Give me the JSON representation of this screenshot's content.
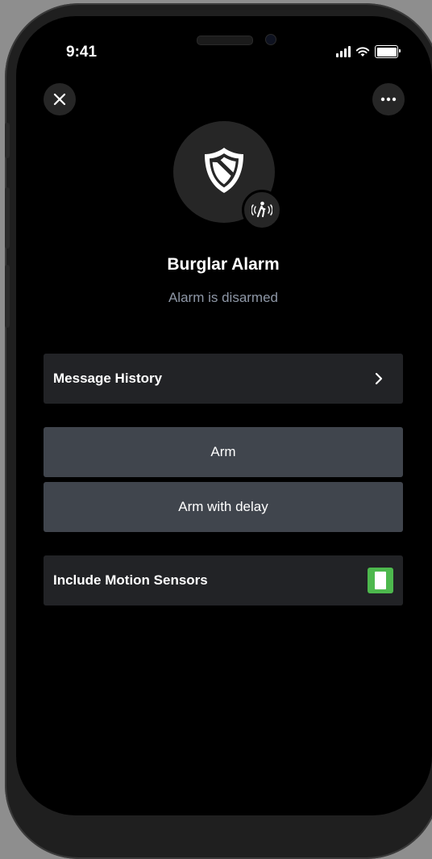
{
  "status_bar": {
    "time": "9:41"
  },
  "header": {
    "close_icon": "close-icon",
    "more_icon": "more-dots-icon"
  },
  "device": {
    "name": "Burglar Alarm",
    "status": "Alarm is disarmed",
    "icon": "shield-icon",
    "badge_icon": "motion-sensor-icon"
  },
  "menu": {
    "message_history_label": "Message History"
  },
  "actions": {
    "arm_label": "Arm",
    "arm_delay_label": "Arm with delay"
  },
  "settings": {
    "motion_sensors_label": "Include Motion Sensors",
    "motion_sensors_enabled": true,
    "toggle_color": "#4db84d"
  },
  "colors": {
    "background": "#000000",
    "row_dark": "#222326",
    "row_button": "#40454d",
    "subtitle": "#8e97a6"
  }
}
